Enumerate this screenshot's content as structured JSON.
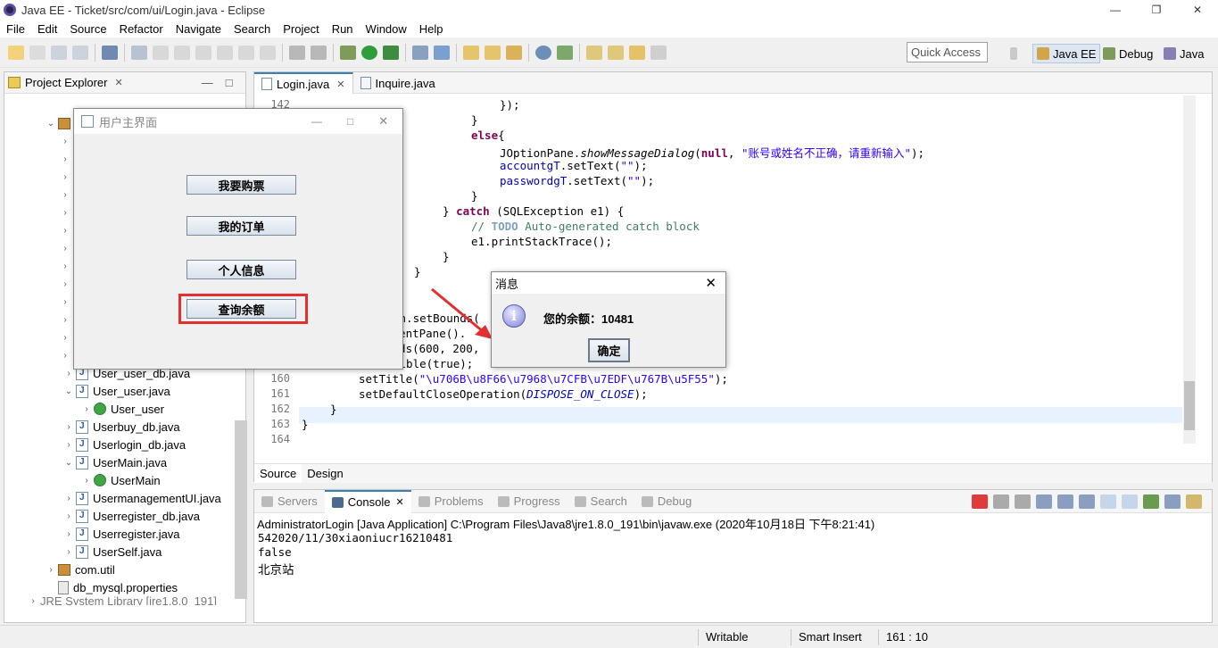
{
  "window": {
    "title": "Java EE - Ticket/src/com/ui/Login.java - Eclipse"
  },
  "menu": [
    "File",
    "Edit",
    "Source",
    "Refactor",
    "Navigate",
    "Search",
    "Project",
    "Run",
    "Window",
    "Help"
  ],
  "quick_access": "Quick Access",
  "perspectives": {
    "javaee": "Java EE",
    "debug": "Debug",
    "java": "Java"
  },
  "project_explorer": {
    "title": "Project Explorer",
    "items": [
      {
        "label": "User_user_db.java"
      },
      {
        "label": "User_user.java"
      },
      {
        "label": "User_user"
      },
      {
        "label": "Userbuy_db.java"
      },
      {
        "label": "Userlogin_db.java"
      },
      {
        "label": "UserMain.java"
      },
      {
        "label": "UserMain"
      },
      {
        "label": "UsermanagementUI.java"
      },
      {
        "label": "Userregister_db.java"
      },
      {
        "label": "Userregister.java"
      },
      {
        "label": "UserSelf.java"
      },
      {
        "label": "com.util"
      },
      {
        "label": "db_mysql.properties"
      },
      {
        "label": "JRE System Library [jre1.8.0_191]"
      }
    ]
  },
  "editor": {
    "tabs": [
      "Login.java",
      "Inquire.java"
    ],
    "line_numbers": [
      "142",
      "160",
      "161",
      "162",
      "163",
      "164"
    ],
    "code": {
      "l1": "});",
      "l2": "}",
      "l3a": "else",
      "l3b": "{",
      "l4a": "JOptionPane.",
      "l4b": "showMessageDialog",
      "l4c": "(",
      "l4d": "null",
      "l4e": ", ",
      "l4f": "\"账号或姓名不正确，请重新输入\"",
      "l4g": ");",
      "l5a": "accountgT",
      "l5b": ".setText(",
      "l5c": "\"\"",
      "l5d": ");",
      "l6a": "passwordgT",
      "l6b": ".setText(",
      "l6c": "\"\"",
      "l6d": ");",
      "l7": "}",
      "l8a": "} ",
      "l8b": "catch",
      "l8c": " (SQLException e1) {",
      "l9a": "// ",
      "l9b": "TODO",
      "l9c": " Auto-generated catch block",
      "l10": "e1.printStackTrace();",
      "l11": "}",
      "l12": "}",
      "l13": "tn.setBounds(",
      "l14": "ntentPane().",
      "l15": "unds(600, 200,",
      "l16": "sible(true);",
      "l17a": "setTitle(",
      "l17b": "\"\\u706B\\u8F66\\u7968\\u7CFB\\u7EDF\\u767B\\u5F55\"",
      "l17c": ");",
      "l18a": "setDefaultCloseOperation(",
      "l18b": "DISPOSE_ON_CLOSE",
      "l18c": ");",
      "l19": "}",
      "l20": "}"
    },
    "source_tab": "Source",
    "design_tab": "Design"
  },
  "console": {
    "tabs": [
      "Servers",
      "Console",
      "Problems",
      "Progress",
      "Search",
      "Debug"
    ],
    "label": "AdministratorLogin [Java Application] C:\\Program Files\\Java8\\jre1.8.0_191\\bin\\javaw.exe (2020年10月18日 下午8:21:41)",
    "lines": [
      "542020/11/30xiaoniucr16210481",
      "false",
      "北京站"
    ]
  },
  "status": {
    "writable": "Writable",
    "insert": "Smart Insert",
    "position": "161 : 10"
  },
  "user_main": {
    "title": "用户主界面",
    "buttons": [
      "我要购票",
      "我的订单",
      "个人信息",
      "查询余额"
    ]
  },
  "message": {
    "title": "消息",
    "text": "您的余额：10481",
    "ok": "确定",
    "icon": "i"
  },
  "colors": {
    "highlight_box": "#e23030",
    "accent": "#3c7fb1"
  }
}
